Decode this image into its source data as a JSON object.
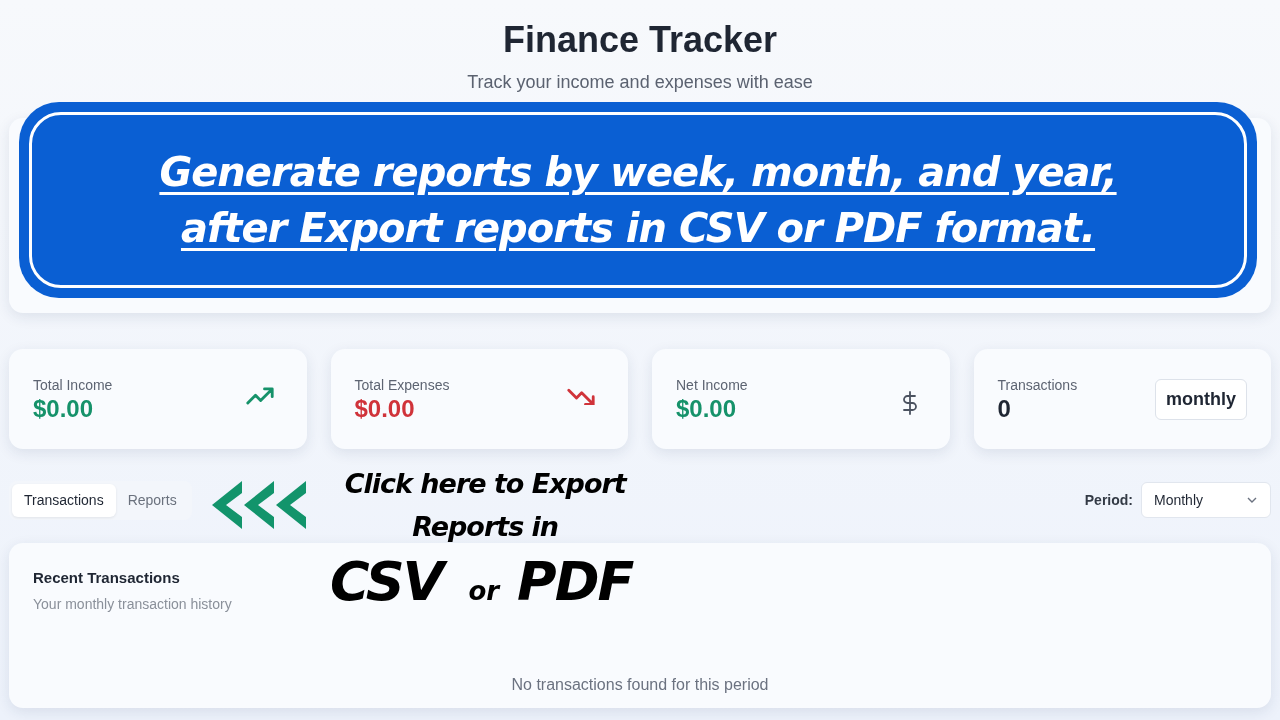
{
  "header": {
    "title": "Finance Tracker",
    "subtitle": "Track your income and expenses with ease"
  },
  "banner": {
    "lines": [
      "Generate reports by week, month, and year,",
      "after Export reports in CSV or PDF format."
    ]
  },
  "stats": [
    {
      "kind": "up",
      "label": "Total Income",
      "value": "$0.00",
      "color": "#16926a"
    },
    {
      "kind": "down",
      "label": "Total Expenses",
      "value": "$0.00",
      "color": "#d0333a"
    },
    {
      "kind": "dollar",
      "label": "Net Income",
      "value": "$0.00",
      "color": "#16926a"
    },
    {
      "kind": "badge",
      "label": "Transactions",
      "value": "0",
      "color": "#1f2633",
      "badge": "monthly"
    }
  ],
  "tabs": [
    {
      "label": "Transactions",
      "selected": true
    },
    {
      "label": "Reports",
      "selected": false
    }
  ],
  "annotation": {
    "lines": [
      "Click here to Export",
      "Reports in"
    ],
    "big": [
      "CSV",
      "or",
      "PDF"
    ]
  },
  "period": {
    "label": "Period:",
    "value": "Monthly"
  },
  "transactions_panel": {
    "title": "Recent Transactions",
    "subtitle": "Your monthly transaction history",
    "empty_message": "No transactions found for this period"
  }
}
